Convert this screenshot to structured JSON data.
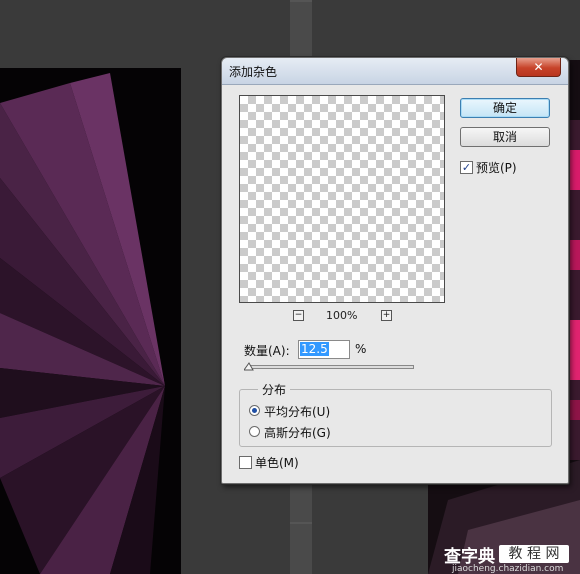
{
  "dialog": {
    "title": "添加杂色",
    "close_glyph": "✕",
    "ok_label": "确定",
    "cancel_label": "取消",
    "preview_label": "预览(P)",
    "preview_checked": true,
    "zoom_out_glyph": "−",
    "zoom_in_glyph": "+",
    "zoom_level": "100%",
    "amount_label": "数量(A):",
    "amount_value": "12.5",
    "amount_unit": "%",
    "distribution_title": "分布",
    "uniform_label": "平均分布(U)",
    "gaussian_label": "高斯分布(G)",
    "distribution_selected": "uniform",
    "monochrome_label": "单色(M)",
    "monochrome_checked": false
  },
  "watermark": {
    "brand": "查字典",
    "section": "教 程 网",
    "url": "jiaocheng.chazidian.com"
  },
  "colors": {
    "titlebar": "#c8d4e4",
    "close_button": "#c7432a",
    "dialog_bg": "#e8e8e8",
    "artwork_purple": "#5a2a55",
    "artwork_pink": "#d81b6a"
  },
  "icons": [
    "checkbox-check-icon",
    "radio-dot-icon",
    "slider-thumb-icon",
    "zoom-out-icon",
    "zoom-in-icon",
    "close-icon"
  ]
}
